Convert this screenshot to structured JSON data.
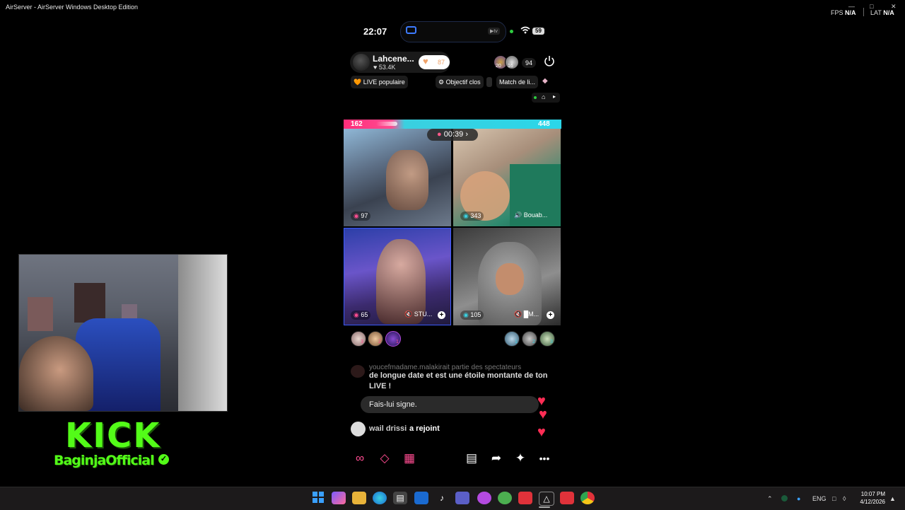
{
  "window": {
    "title": "AirServer - AirServer Windows Desktop Edition",
    "fps_label": "FPS",
    "fps_value": "N/A",
    "lat_label": "LAT",
    "lat_value": "N/A"
  },
  "phone_status": {
    "time": "22:07",
    "tv_badge": "▶tv",
    "battery": "59",
    "wifi": "◠"
  },
  "host": {
    "name": "Lahcene...",
    "likes": "♥ 53.4K",
    "follow_heart": "♥",
    "follow_count": "87",
    "viewer_count": "94",
    "viewer_badges": [
      "20",
      "16"
    ]
  },
  "chips": {
    "live": "🧡 LIVE populaire",
    "objective": "⚙ Objectif clos",
    "match": "Match de li...",
    "gem": "◆"
  },
  "battle": {
    "score_left": "162",
    "score_right": "448",
    "timer": "00:39",
    "timer_arrow": "›"
  },
  "cells": [
    {
      "score": "97",
      "label": ""
    },
    {
      "score": "343",
      "label": "🔊 Bouab..."
    },
    {
      "score": "65",
      "label": "🔇 STU..."
    },
    {
      "score": "105",
      "label": "🔇 █M..."
    }
  ],
  "rank_badges": {
    "left": [
      "3",
      "2",
      "1"
    ],
    "right": [
      "1",
      "2",
      "3"
    ]
  },
  "chat": {
    "faded_line": "youcefmadame.malakirait partie des spectateurs",
    "message": "de longue date et est une étoile montante de ton LIVE !",
    "suggestion": "Fais-lui signe.",
    "join_name": "wail drissi",
    "join_text": "a rejoint"
  },
  "overlay": {
    "kick_word": "KICK",
    "kick_user": "BaginjaOfficial",
    "verified": "✓"
  },
  "taskbar": {
    "lang": "ENG",
    "time": "10:07 PM",
    "date": "4/12/2026"
  },
  "colors": {
    "kick_green": "#53fc18",
    "pink_team": "#ff2d7a",
    "cyan_team": "#2bd6e8",
    "heart": "#ff2d55"
  }
}
